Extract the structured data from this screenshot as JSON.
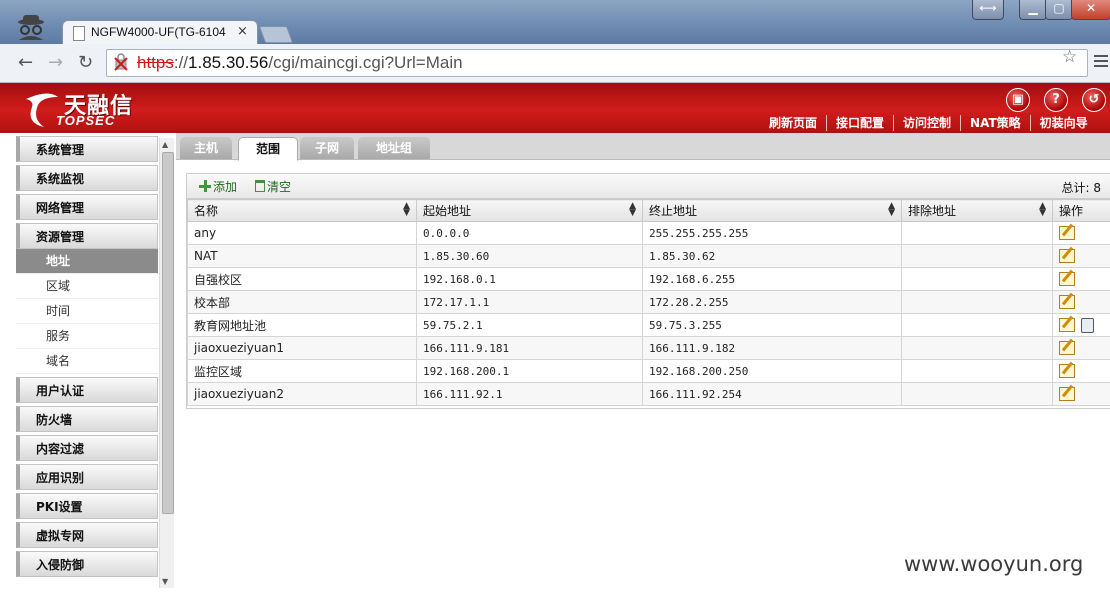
{
  "browser": {
    "tab_title": "NGFW4000-UF(TG-6104",
    "tab_close": "×",
    "url_scheme": "https",
    "url_rest": "://1.85.30.56/cgi/maincgi.cgi?Url=Main",
    "url_host": "1.85.30.56",
    "url_path": "/cgi/maincgi.cgi?Url=Main"
  },
  "header": {
    "logo_cn": "天融信",
    "logo_en": "TOPSEC",
    "links": [
      "刷新页面",
      "接口配置",
      "访问控制",
      "NAT策略",
      "初装向导"
    ],
    "icons": [
      "save-icon",
      "help-icon",
      "logout-icon"
    ]
  },
  "sidebar": {
    "categories": {
      "c1": "系统管理",
      "c2": "系统监视",
      "c3": "网络管理",
      "c4": "资源管理",
      "c5": "用户认证",
      "c6": "防火墙",
      "c7": "内容过滤",
      "c8": "应用识别",
      "c9": "PKI设置",
      "c10": "虚拟专网",
      "c11": "入侵防御"
    },
    "resource_items": [
      "地址",
      "区域",
      "时间",
      "服务",
      "域名"
    ],
    "active_item": "地址"
  },
  "content_tabs": [
    "主机",
    "范围",
    "子网",
    "地址组"
  ],
  "active_tab": "范围",
  "panel": {
    "add_label": "添加",
    "clear_label": "清空",
    "total_label": "总计: 8"
  },
  "table": {
    "columns": [
      "名称",
      "起始地址",
      "终止地址",
      "排除地址",
      "操作"
    ],
    "rows": [
      {
        "name": "any",
        "start": "0.0.0.0",
        "end": "255.255.255.255",
        "exclude": ""
      },
      {
        "name": "NAT",
        "start": "1.85.30.60",
        "end": "1.85.30.62",
        "exclude": ""
      },
      {
        "name": "自强校区",
        "start": "192.168.0.1",
        "end": "192.168.6.255",
        "exclude": ""
      },
      {
        "name": "校本部",
        "start": "172.17.1.1",
        "end": "172.28.2.255",
        "exclude": ""
      },
      {
        "name": "教育网地址池",
        "start": "59.75.2.1",
        "end": "59.75.3.255",
        "exclude": ""
      },
      {
        "name": "jiaoxueziyuan1",
        "start": "166.111.9.181",
        "end": "166.111.9.182",
        "exclude": ""
      },
      {
        "name": "监控区域",
        "start": "192.168.200.1",
        "end": "192.168.200.250",
        "exclude": ""
      },
      {
        "name": "jiaoxueziyuan2",
        "start": "166.111.92.1",
        "end": "166.111.92.254",
        "exclude": ""
      }
    ]
  },
  "watermark": "www.wooyun.org"
}
